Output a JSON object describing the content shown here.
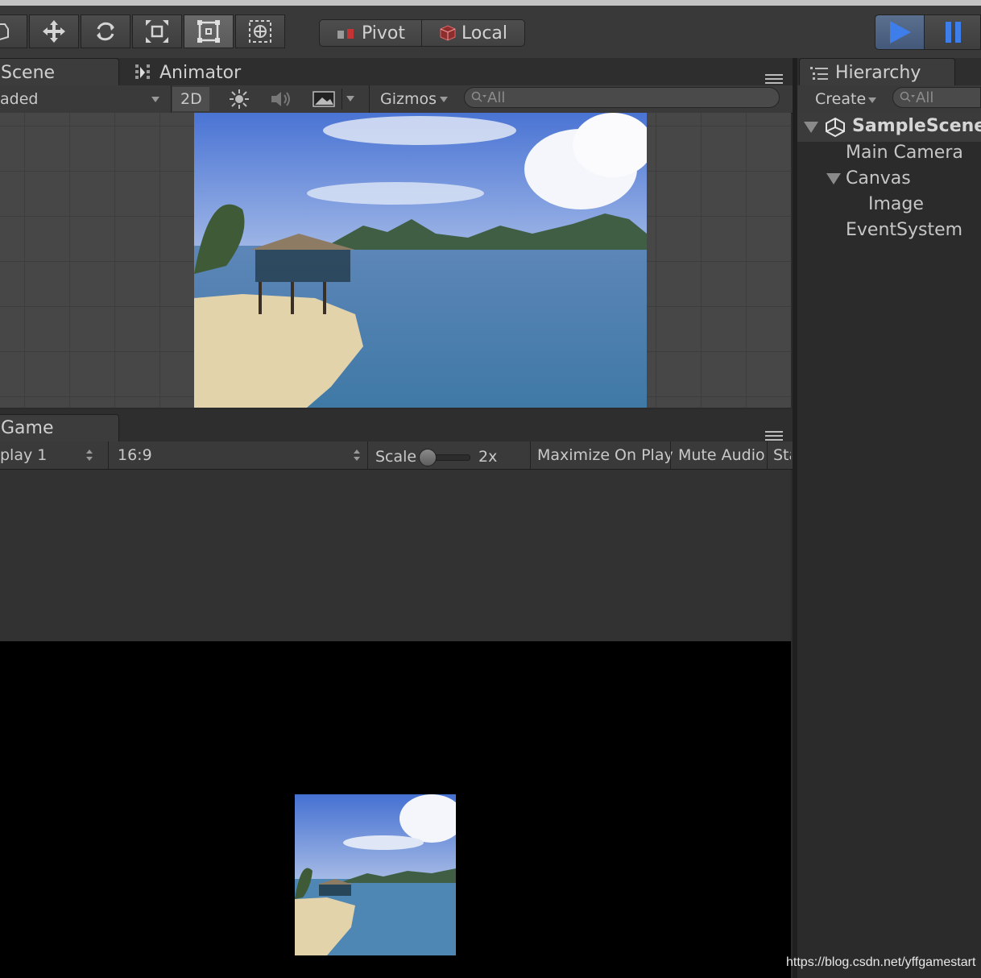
{
  "toolbar": {
    "tools": [
      "hand-tool",
      "move-tool",
      "rotate-tool",
      "scale-tool",
      "rect-tool",
      "transform-tool"
    ],
    "active_tool": "rect-tool",
    "pivot_label": "Pivot",
    "local_label": "Local",
    "accent_color": "#3d79d6"
  },
  "scene_panel": {
    "tabs": [
      {
        "label": "Scene"
      },
      {
        "label": "Animator"
      }
    ],
    "shading_value": "aded",
    "mode_2d_label": "2D",
    "gizmos_label": "Gizmos",
    "search_placeholder": "All"
  },
  "game_panel": {
    "tab_label": "Game",
    "display_value": "play 1",
    "aspect_value": "16:9",
    "scale_label": "Scale",
    "scale_value": "2x",
    "maximize_label": "Maximize On Play",
    "mute_label": "Mute Audio",
    "stats_label": "Sta"
  },
  "hierarchy": {
    "tab_label": "Hierarchy",
    "create_label": "Create",
    "search_placeholder": "All",
    "items": [
      {
        "label": "SampleScene"
      },
      {
        "label": "Main Camera"
      },
      {
        "label": "Canvas"
      },
      {
        "label": "Image"
      },
      {
        "label": "EventSystem"
      }
    ]
  },
  "watermark": "https://blog.csdn.net/yffgamestart"
}
